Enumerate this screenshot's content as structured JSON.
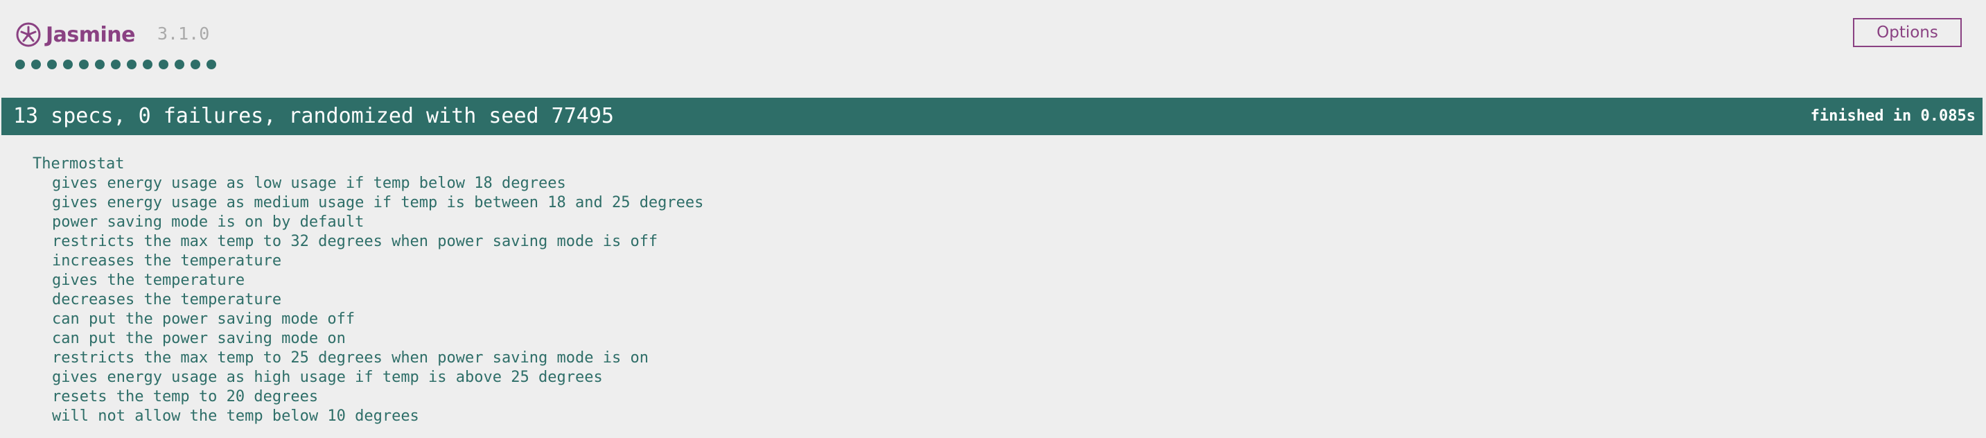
{
  "header": {
    "logo_text": "Jasmine",
    "version": "3.1.0",
    "options_label": "Options"
  },
  "symbol_summary": {
    "passed_count": 13,
    "status": "passed"
  },
  "bar": {
    "overall": "13 specs, 0 failures, randomized with seed 77495",
    "duration": "finished in 0.085s"
  },
  "suite": {
    "title": "Thermostat",
    "specs": [
      "gives energy usage as low usage if temp below 18 degrees",
      "gives energy usage as medium usage if temp is between 18 and 25 degrees",
      "power saving mode is on by default",
      "restricts the max temp to 32 degrees when power saving mode is off",
      "increases the temperature",
      "gives the temperature",
      "decreases the temperature",
      "can put the power saving mode off",
      "can put the power saving mode on",
      "restricts the max temp to 25 degrees when power saving mode is on",
      "gives energy usage as high usage if temp is above 25 degrees",
      "resets the temp to 20 degrees",
      "will not allow the temp below 10 degrees"
    ]
  },
  "colors": {
    "passed": "#2e6e68",
    "brand": "#8a4182",
    "background": "#eeeeee",
    "version_gray": "#aaaaaa"
  }
}
